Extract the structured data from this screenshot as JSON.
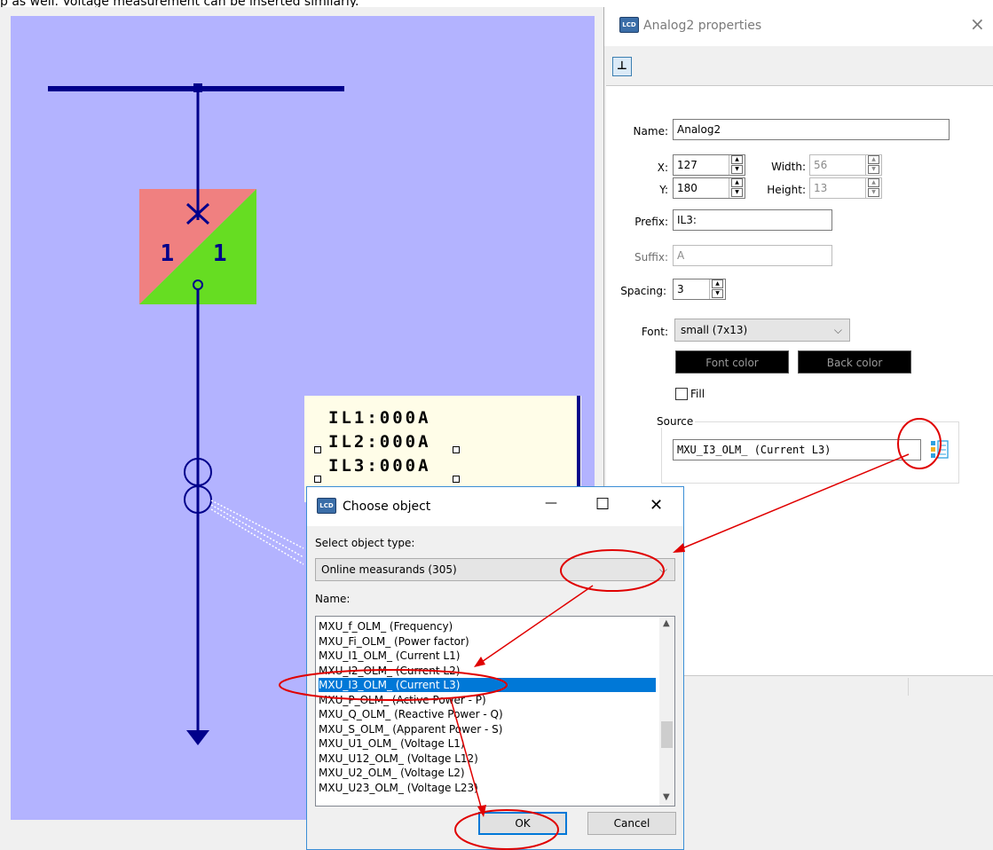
{
  "caption": "p as well. Voltage measurement can be inserted similarly.",
  "lcd": {
    "switch_text": "1 1",
    "measurements": [
      "IL1:000A",
      "IL2:000A",
      "IL3:000A"
    ]
  },
  "properties": {
    "title": "Analog2 properties",
    "title_icon": "LCD",
    "close_glyph": "×",
    "pin_glyph": "⊥",
    "name_label": "Name:",
    "name_value": "Analog2",
    "x_label": "X:",
    "x_value": "127",
    "y_label": "Y:",
    "y_value": "180",
    "width_label": "Width:",
    "width_value": "56",
    "height_label": "Height:",
    "height_value": "13",
    "prefix_label": "Prefix:",
    "prefix_value": "IL3:",
    "suffix_label": "Suffix:",
    "suffix_value": "A",
    "spacing_label": "Spacing:",
    "spacing_value": "3",
    "font_label": "Font:",
    "font_value": "small (7x13)",
    "font_color_label": "Font color",
    "back_color_label": "Back color",
    "fill_label": "Fill",
    "fill_checked": false,
    "source_group_label": "Source",
    "source_value": "MXU_I3_OLM_ (Current L3)"
  },
  "dialog": {
    "title": "Choose object",
    "title_icon": "LCD",
    "minimize_glyph": "—",
    "maximize_glyph": "☐",
    "close_glyph": "✕",
    "object_type_label": "Select object type:",
    "object_type_value": "Online measurands (305)",
    "name_label": "Name:",
    "items": [
      "MXU_f_OLM_ (Frequency)",
      "MXU_Fi_OLM_ (Power factor)",
      "MXU_I1_OLM_ (Current L1)",
      "MXU_I2_OLM_ (Current L2)",
      "MXU_I3_OLM_ (Current L3)",
      "MXU_P_OLM_ (Active Power - P)",
      "MXU_Q_OLM_ (Reactive Power - Q)",
      "MXU_S_OLM_ (Apparent Power - S)",
      "MXU_U1_OLM_ (Voltage L1)",
      "MXU_U12_OLM_ (Voltage L12)",
      "MXU_U2_OLM_ (Voltage L2)",
      "MXU_U23_OLM_ (Voltage L23)"
    ],
    "selected_index": 4,
    "ok_label": "OK",
    "cancel_label": "Cancel"
  },
  "colors": {
    "canvas": "#b3b3ff",
    "line": "#00008b",
    "switch_open": "#f08080",
    "switch_closed": "#66dd22",
    "annotation": "#e00000",
    "selection": "#0078d7"
  }
}
